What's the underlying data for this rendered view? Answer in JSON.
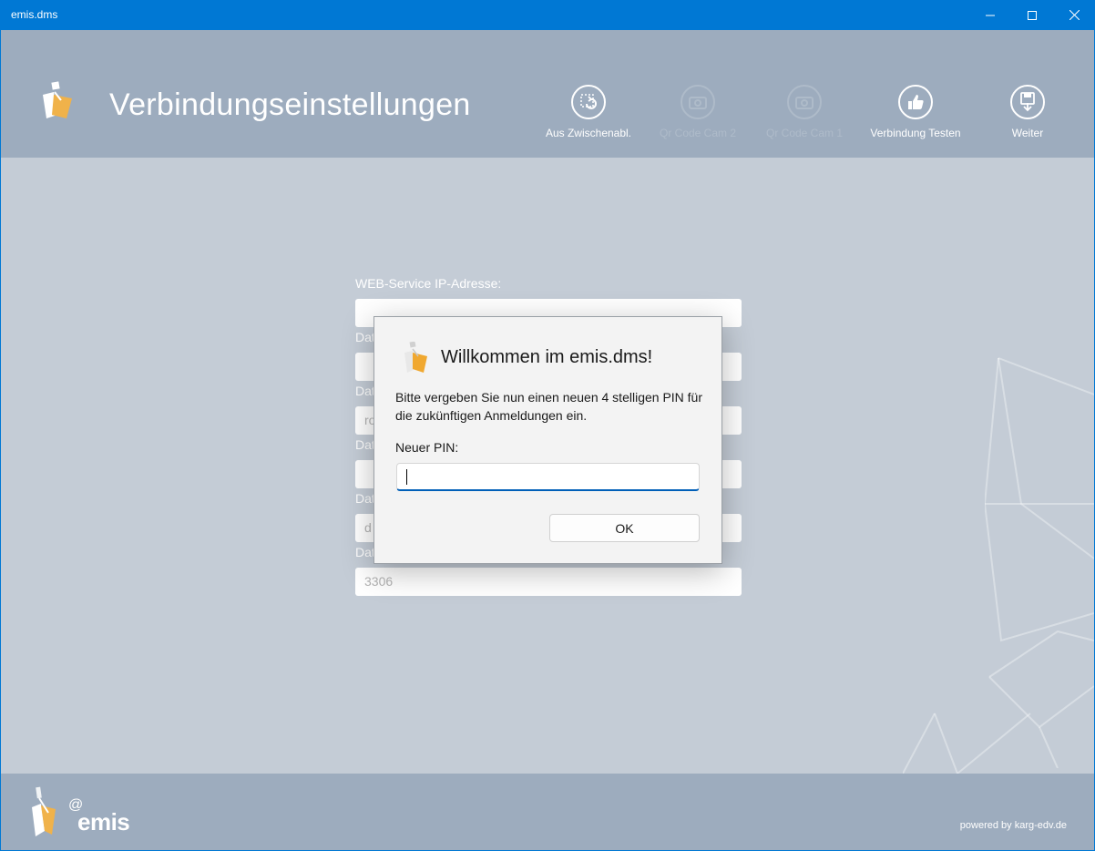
{
  "window": {
    "title": "emis.dms"
  },
  "header": {
    "title": "Verbindungseinstellungen",
    "tools": [
      {
        "label": "Aus Zwischenabl.",
        "icon": "clipboard-refresh-icon",
        "enabled": true
      },
      {
        "label": "Qr Code Cam 2",
        "icon": "camera-icon",
        "enabled": false
      },
      {
        "label": "Qr Code Cam 1",
        "icon": "camera-icon",
        "enabled": false
      },
      {
        "label": "Verbindung Testen",
        "icon": "thumbs-up-icon",
        "enabled": true
      },
      {
        "label": "Weiter",
        "icon": "save-download-icon",
        "enabled": true
      }
    ]
  },
  "form": {
    "fields": [
      {
        "label": "WEB-Service IP-Adresse:",
        "value": ""
      },
      {
        "label": "Dat",
        "value": ""
      },
      {
        "label": "Dat",
        "value": "ro"
      },
      {
        "label": "Dat",
        "value": ""
      },
      {
        "label": "Dat",
        "value": "d"
      },
      {
        "label": "Dat",
        "value": "3306"
      }
    ]
  },
  "footer": {
    "brand": "emis",
    "brand_prefix": "@",
    "powered_by": "powered by karg-edv.de"
  },
  "dialog": {
    "title": "Willkommen im emis.dms!",
    "message": "Bitte vergeben Sie nun einen neuen 4 stelligen PIN für die zukünftigen Anmeldungen ein.",
    "pin_label": "Neuer PIN:",
    "pin_value": "",
    "ok_label": "OK"
  },
  "colors": {
    "titlebar": "#0078d4",
    "header": "#9dacbe",
    "content": "#c4ccd6",
    "logo_orange": "#f0a830"
  }
}
